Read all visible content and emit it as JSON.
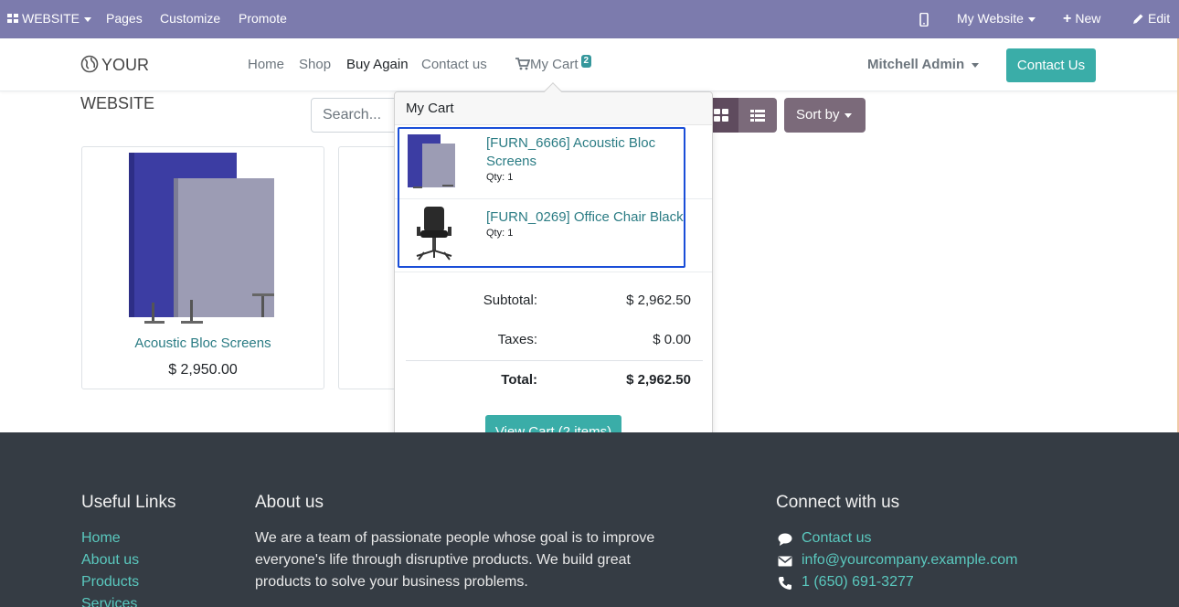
{
  "admin_bar": {
    "website_label": "WEBSITE",
    "pages_label": "Pages",
    "customize_label": "Customize",
    "promote_label": "Promote",
    "my_website_label": "My Website",
    "new_label": "New",
    "edit_label": "Edit",
    "bg_color": "#7c7bad"
  },
  "header": {
    "logo_text": "YOUR WEBSITE",
    "nav": [
      "Home",
      "Shop",
      "Buy Again",
      "Contact us"
    ],
    "cart_label": "My Cart",
    "cart_count": "2",
    "user_name": "Mitchell Admin",
    "contact_button": "Contact Us"
  },
  "shop": {
    "search_placeholder": "Search...",
    "sort_label": "Sort by",
    "products": [
      {
        "name": "Acoustic Bloc Screens",
        "price": "$ 2,950.00"
      }
    ]
  },
  "cart_popover": {
    "title": "My Cart",
    "lines": [
      {
        "name": "[FURN_6666] Acoustic Bloc Screens",
        "qty": "Qty: 1",
        "icon": "acoustic-screen-image"
      },
      {
        "name": "[FURN_0269] Office Chair Black",
        "qty": "Qty: 1",
        "icon": "office-chair-image"
      }
    ],
    "subtotal_label": "Subtotal:",
    "subtotal_value": "$ 2,962.50",
    "taxes_label": "Taxes:",
    "taxes_value": "$ 0.00",
    "total_label": "Total:",
    "total_value": "$ 2,962.50",
    "view_cart_button": "View Cart (2 items)"
  },
  "footer": {
    "useful_links_title": "Useful Links",
    "useful_links": [
      "Home",
      "About us",
      "Products",
      "Services"
    ],
    "about_title": "About us",
    "about_text": "We are a team of passionate people whose goal is to improve everyone's life through disruptive products. We build great products to solve your business problems.",
    "connect_title": "Connect with us",
    "connect_links": [
      "Contact us",
      "info@yourcompany.example.com",
      "1 (650) 691-3277"
    ],
    "bg_color": "#353c44",
    "link_color": "#5ac8be"
  }
}
